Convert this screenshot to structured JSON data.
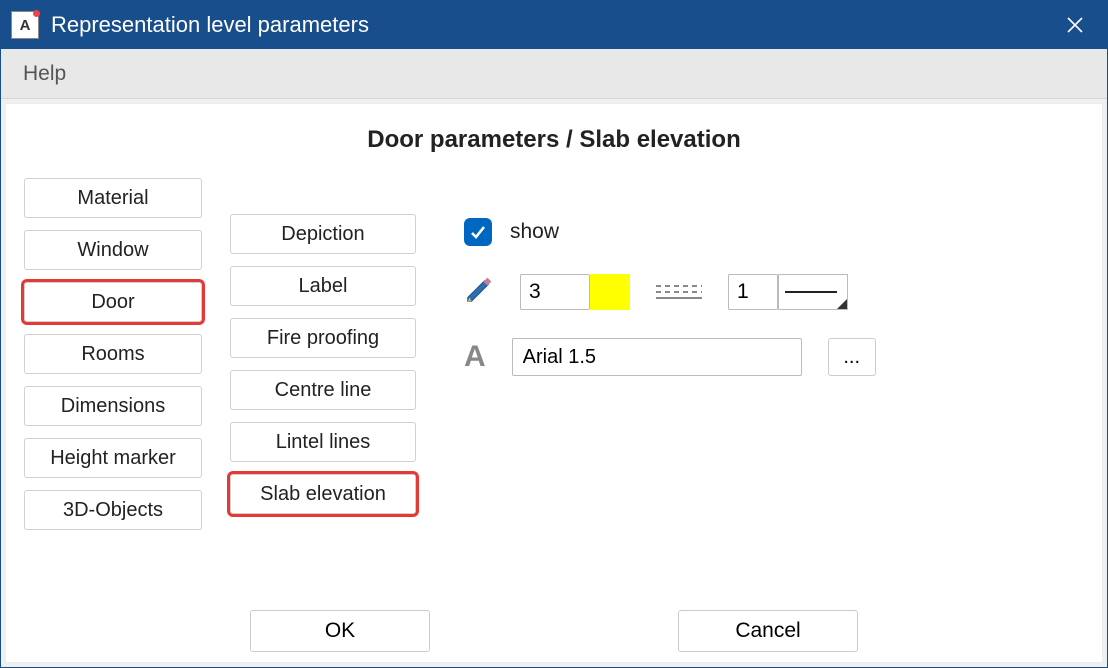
{
  "window": {
    "title": "Representation level parameters"
  },
  "menu": {
    "help": "Help"
  },
  "page": {
    "title": "Door parameters / Slab elevation"
  },
  "left_list": [
    "Material",
    "Window",
    "Door",
    "Rooms",
    "Dimensions",
    "Height marker",
    "3D-Objects"
  ],
  "left_selected_index": 2,
  "mid_list": [
    "Depiction",
    "Label",
    "Fire proofing",
    "Centre line",
    "Lintel lines",
    "Slab elevation"
  ],
  "mid_selected_index": 5,
  "settings": {
    "show_label": "show",
    "show_checked": true,
    "pen_value": "3",
    "color_hex": "#ffff00",
    "line_value": "1",
    "font_value": "Arial 1.5",
    "more_label": "..."
  },
  "footer": {
    "ok": "OK",
    "cancel": "Cancel"
  }
}
